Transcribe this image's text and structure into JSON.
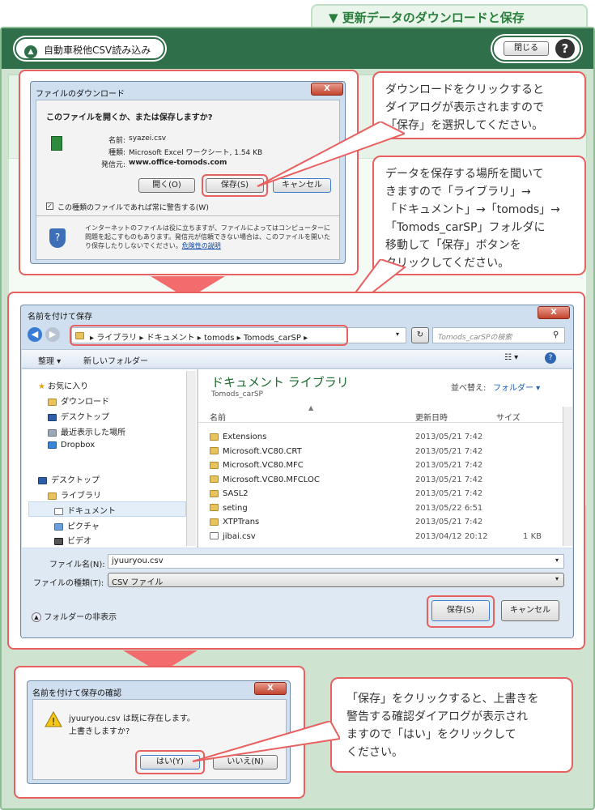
{
  "page_title": "▼ 更新データのダウンロードと保存",
  "app": {
    "import_button": "自動車税他CSV読み込み",
    "close_button": "閉じる",
    "help_button": "?"
  },
  "download_dialog": {
    "title": "ファイルのダウンロード",
    "close": "X",
    "question": "このファイルを開くか、または保存しますか?",
    "name_label": "名前:",
    "name_value": "syazei.csv",
    "type_label": "種類:",
    "type_value": "Microsoft Excel ワークシート, 1.54 KB",
    "from_label": "発信元:",
    "from_value": "www.office-tomods.com",
    "open_button": "開く(O)",
    "save_button": "保存(S)",
    "cancel_button": "キャンセル",
    "checkbox_label": "この種類のファイルであれば常に警告する(W)",
    "warning_text": "インターネットのファイルは役に立ちますが、ファイルによってはコンピューターに問題を起こすものもあります。発信元が信頼できない場合は、このファイルを開いたり保存したりしないでください。",
    "risk_link": "危険性の説明"
  },
  "callouts": {
    "c1": "ダウンロードをクリックすると\nダイアログが表示されますので\n「保存」を選択してください。",
    "c2": "データを保存する場所を聞いて\nきますので「ライブラリ」→\n「ドキュメント」→「tomods」→\n「Tomods_carSP」フォルダに\n移動して「保存」ボタンを\nクリックしてください。",
    "c3": "「保存」をクリックすると、上書きを\n警告する確認ダイアログが表示され\nますので「はい」をクリックして\nください。"
  },
  "save_dialog": {
    "title": "名前を付けて保存",
    "close": "X",
    "breadcrumb": [
      "ライブラリ",
      "ドキュメント",
      "tomods",
      "Tomods_carSP"
    ],
    "search_placeholder": "Tomods_carSPの検索",
    "toolbar_organize": "整理 ▾",
    "toolbar_new_folder": "新しいフォルダー",
    "nav": {
      "favorites": "お気に入り",
      "downloads": "ダウンロード",
      "desktop_fav": "デスクトップ",
      "recent": "最近表示した場所",
      "dropbox": "Dropbox",
      "desktop": "デスクトップ",
      "libraries": "ライブラリ",
      "documents": "ドキュメント",
      "pictures": "ピクチャ",
      "videos": "ビデオ"
    },
    "library_title": "ドキュメント ライブラリ",
    "library_sub": "Tomods_carSP",
    "sort_label": "並べ替え:",
    "sort_value": "フォルダー ▾",
    "col_name": "名前",
    "col_date": "更新日時",
    "col_size": "サイズ",
    "files": [
      {
        "name": "Extensions",
        "date": "2013/05/21 7:42",
        "size": ""
      },
      {
        "name": "Microsoft.VC80.CRT",
        "date": "2013/05/21 7:42",
        "size": ""
      },
      {
        "name": "Microsoft.VC80.MFC",
        "date": "2013/05/21 7:42",
        "size": ""
      },
      {
        "name": "Microsoft.VC80.MFCLOC",
        "date": "2013/05/21 7:42",
        "size": ""
      },
      {
        "name": "SASL2",
        "date": "2013/05/21 7:42",
        "size": ""
      },
      {
        "name": "seting",
        "date": "2013/05/22 6:51",
        "size": ""
      },
      {
        "name": "XTPTrans",
        "date": "2013/05/21 7:42",
        "size": ""
      },
      {
        "name": "jibai.csv",
        "date": "2013/04/12 20:12",
        "size": "1 KB"
      }
    ],
    "filename_label": "ファイル名(N):",
    "filename_value": "jyuuryou.csv",
    "filetype_label": "ファイルの種類(T):",
    "filetype_value": "CSV ファイル",
    "hide_folders": "フォルダーの非表示",
    "save_button": "保存(S)",
    "cancel_button": "キャンセル"
  },
  "confirm_dialog": {
    "title": "名前を付けて保存の確認",
    "close": "X",
    "message1": "jyuuryou.csv は既に存在します。",
    "message2": "上書きしますか?",
    "yes_button": "はい(Y)",
    "no_button": "いいえ(N)"
  }
}
